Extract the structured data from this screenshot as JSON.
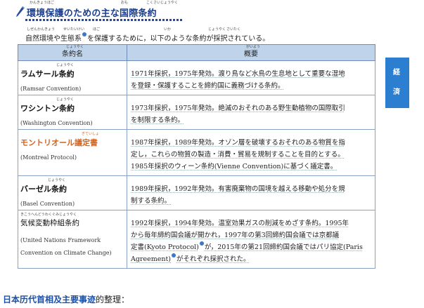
{
  "title": "環境保護のための主な国際条約",
  "title_ruby": {
    "kankyou": "かんきょうほご",
    "shu": "おも",
    "kokusai": "こくさいじょうやく"
  },
  "intro": {
    "part1": "自然環境や生態系",
    "part2": "を保護するために，以下のような条約が採択されている。",
    "ruby": {
      "shizen": "しぜんかんきょう",
      "seitai": "せいたいけい",
      "hogo": "ほご",
      "ika": "いか",
      "jouyaku": "じょうやく",
      "saitaku": "さいたく"
    }
  },
  "table": {
    "header_name": "条約名",
    "header_name_ruby": "じょうやく",
    "header_desc": "概要",
    "header_desc_ruby": "がいよう",
    "rows": [
      {
        "name": "ラムサール条約",
        "name_ruby": "じょうやく",
        "english": "(Ramsar Convention)",
        "lines": [
          "1971年採択，1975年発効。渡り鳥など水鳥の生息地として重要な湿地",
          "を登録・保護することを締約国に義務づける条約。"
        ]
      },
      {
        "name": "ワシントン条約",
        "name_ruby": "じょうやく",
        "english": "(Washington Convention)",
        "lines": [
          "1973年採択，1975年発効。絶滅のおそれのある野生動植物の国際取引",
          "を制限する条約。"
        ]
      },
      {
        "name": "モントリオール議定書",
        "name_ruby": "ぎていしょ",
        "english": "(Montreal Protocol)",
        "lines": [
          "1987年採択，1989年発効。オゾン層を破壊するおそれのある物質を指",
          "定し，これらの物質の製造・消費・貿易を規制することを目的とする。",
          "1985年採択のウィーン条約(Vienne Convention)に基づく議定書。"
        ]
      },
      {
        "name": "バーゼル条約",
        "name_ruby": "じょうやく",
        "english": "(Basel Convention)",
        "lines": [
          "1989年採択，1992年発効。有害廃棄物の国境を越える移動や処分を規",
          "制する条約。"
        ]
      },
      {
        "name": "気候変動枠組条約",
        "name_ruby": "きこうへんどうわくぐみじょうやく",
        "english_lines": [
          "(United Nations Framework",
          "Convention on Climate Change)"
        ],
        "lines": [
          "1992年採択，1994年発効。温室効果ガスの削減をめざす条約。1995年",
          "から毎年締約国会議が開かれ，1997年の第3回締約国会議では京都議",
          "定書(Kyoto Protocol)",
          "が，2015年の第21回締約国会議ではパリ協定(Paris",
          "Agreement)",
          "がそれぞれ採択された。"
        ]
      }
    ]
  },
  "side_tab": {
    "char1": "経",
    "char2": "済"
  },
  "bottom": {
    "bold": "日本历代首相及主要事迹",
    "rest": "的整理："
  },
  "colors": {
    "title": "#1a3f8f",
    "header_bg": "#bfd3ea",
    "accent_tab": "#2c7fd0",
    "orange": "#d4631e",
    "link": "#1a4fa8"
  }
}
